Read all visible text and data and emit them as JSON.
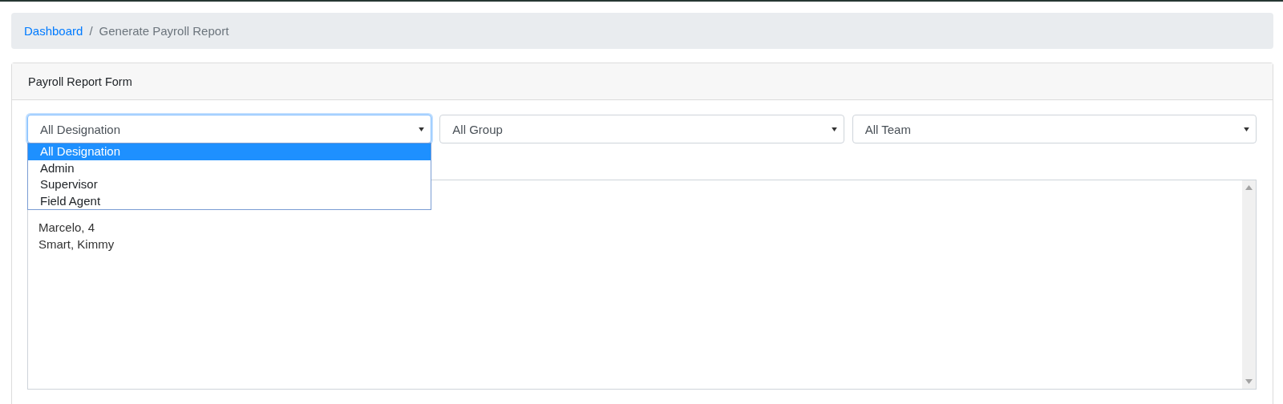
{
  "breadcrumb": [
    {
      "label": "Dashboard",
      "kind": "link"
    },
    {
      "label": "/",
      "kind": "separator"
    },
    {
      "label": "Generate Payroll Report",
      "kind": "current"
    }
  ],
  "card": {
    "title": "Payroll Report Form"
  },
  "filters": [
    {
      "value": "All Designation",
      "focused": true,
      "open": true,
      "options": [
        {
          "label": "All Designation",
          "selected": true
        },
        {
          "label": "Admin",
          "selected": false
        },
        {
          "label": "Supervisor",
          "selected": false
        },
        {
          "label": "Field Agent",
          "selected": false
        }
      ]
    },
    {
      "value": "All Group",
      "focused": false
    },
    {
      "value": "All Team",
      "focused": false
    }
  ],
  "employees": [
    "Marcelo, 4",
    "Smart, Kimmy"
  ]
}
